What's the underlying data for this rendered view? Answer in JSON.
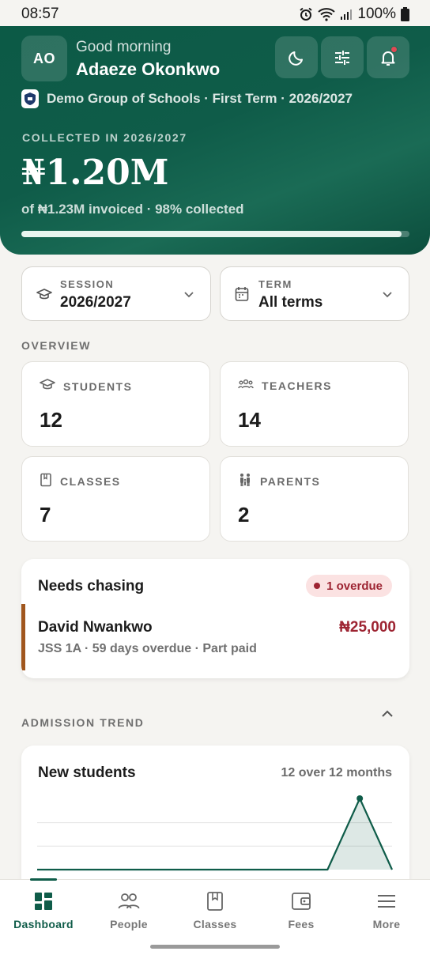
{
  "status_bar": {
    "time": "08:57",
    "battery": "100%"
  },
  "header": {
    "avatar_initials": "AO",
    "greeting": "Good morning",
    "user_name": "Adaeze Okonkwo",
    "org_line": "Demo Group of Schools · First Term · 2026/2027",
    "collected_label": "COLLECTED IN 2026/2027",
    "collected_amount": "₦1.20M",
    "invoiced_line": "of ₦1.23M invoiced · 98% collected",
    "progress_fraction": 0.98,
    "icons": [
      "moon-icon",
      "sliders-icon",
      "bell-icon"
    ]
  },
  "filters": {
    "session": {
      "label": "SESSION",
      "value": "2026/2027"
    },
    "term": {
      "label": "TERM",
      "value": "All terms"
    }
  },
  "overview": {
    "label": "OVERVIEW",
    "cards": [
      {
        "label": "STUDENTS",
        "value": "12"
      },
      {
        "label": "TEACHERS",
        "value": "14"
      },
      {
        "label": "CLASSES",
        "value": "7"
      },
      {
        "label": "PARENTS",
        "value": "2"
      }
    ]
  },
  "needs_chasing": {
    "title": "Needs chasing",
    "badge": "1 overdue",
    "item": {
      "name": "David Nwankwo",
      "amount": "₦25,000",
      "meta": "JSS 1A · 59 days overdue · Part paid"
    }
  },
  "admission": {
    "label": "ADMISSION TREND",
    "card_title": "New students",
    "card_subtitle": "12 over 12 months"
  },
  "chart_data": {
    "type": "area",
    "title": "New students",
    "x": [
      1,
      2,
      3,
      4,
      5,
      6,
      7,
      8,
      9,
      10,
      11,
      12
    ],
    "values": [
      0,
      0,
      0,
      0,
      0,
      0,
      0,
      0,
      0,
      0,
      12,
      0
    ],
    "ylim": [
      0,
      12
    ],
    "grid": true
  },
  "nav": {
    "items": [
      {
        "label": "Dashboard",
        "icon": "dashboard-icon",
        "active": true
      },
      {
        "label": "People",
        "icon": "people-icon",
        "active": false
      },
      {
        "label": "Classes",
        "icon": "book-icon",
        "active": false
      },
      {
        "label": "Fees",
        "icon": "wallet-icon",
        "active": false
      },
      {
        "label": "More",
        "icon": "menu-icon",
        "active": false
      }
    ]
  },
  "colors": {
    "brand": "#0f5c49",
    "overdue": "#9d2432",
    "accent_bar": "#a0561d"
  }
}
